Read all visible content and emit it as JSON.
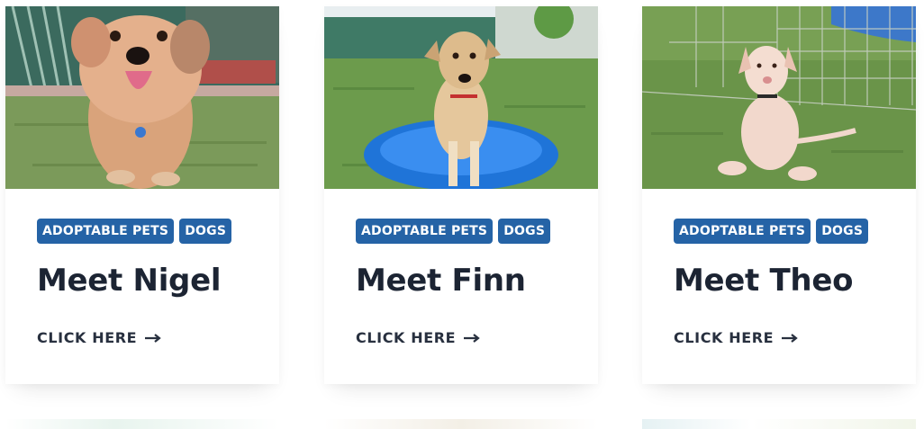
{
  "cards": [
    {
      "tags": [
        "ADOPTABLE PETS",
        "DOGS"
      ],
      "title": "Meet Nigel",
      "cta": "CLICK HERE",
      "image_alt": "Small scruffy tan terrier with tongue out on artificial grass"
    },
    {
      "tags": [
        "ADOPTABLE PETS",
        "DOGS"
      ],
      "title": "Meet Finn",
      "cta": "CLICK HERE",
      "image_alt": "Yellow lab mix sitting in a blue kiddie pool on grass"
    },
    {
      "tags": [
        "ADOPTABLE PETS",
        "DOGS"
      ],
      "title": "Meet Theo",
      "cta": "CLICK HERE",
      "image_alt": "Pale pink-nosed puppy sitting on grass in a wire pen"
    }
  ],
  "colors": {
    "tag_background": "#2563a6",
    "tag_text": "#ffffff",
    "title_text": "#1c2433",
    "cta_text": "#28303f"
  },
  "icons": {
    "cta_arrow": "arrow-right-icon"
  }
}
